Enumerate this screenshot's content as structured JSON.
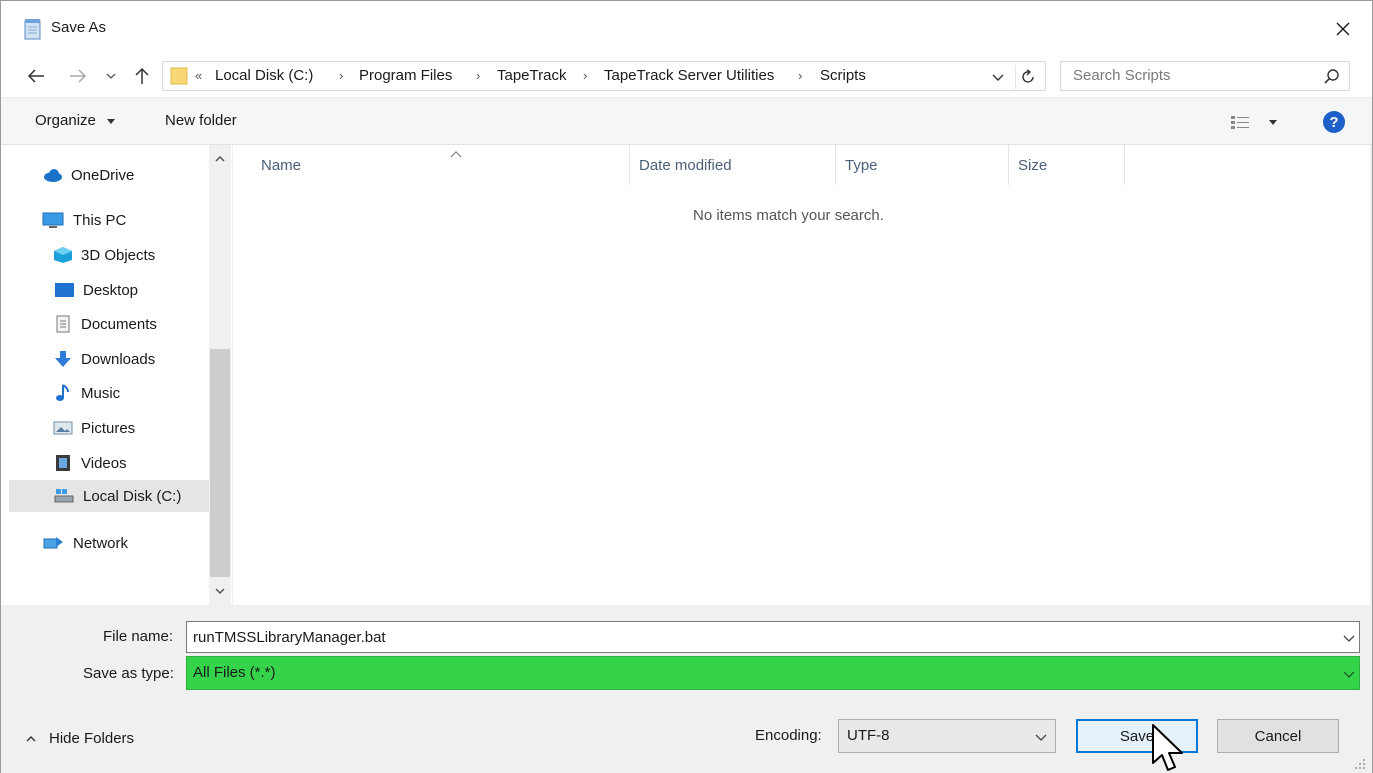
{
  "title": "Save As",
  "address": {
    "overflow": "«",
    "crumbs": [
      "Local Disk (C:)",
      "Program Files",
      "TapeTrack",
      "TapeTrack Server Utilities",
      "Scripts"
    ]
  },
  "search": {
    "placeholder": "Search Scripts"
  },
  "toolbar": {
    "organize_label": "Organize",
    "new_folder_label": "New folder",
    "help_label": "?"
  },
  "nav": {
    "items": [
      {
        "label": "OneDrive",
        "icon": "cloud-icon"
      },
      {
        "label": "This PC",
        "icon": "computer-icon"
      },
      {
        "label": "3D Objects",
        "icon": "cube-icon"
      },
      {
        "label": "Desktop",
        "icon": "desktop-icon"
      },
      {
        "label": "Documents",
        "icon": "document-icon"
      },
      {
        "label": "Downloads",
        "icon": "download-arrow-icon"
      },
      {
        "label": "Music",
        "icon": "music-note-icon"
      },
      {
        "label": "Pictures",
        "icon": "picture-icon"
      },
      {
        "label": "Videos",
        "icon": "film-icon"
      },
      {
        "label": "Local Disk (C:)",
        "icon": "drive-icon",
        "selected": true
      },
      {
        "label": "Network",
        "icon": "network-icon"
      }
    ]
  },
  "list": {
    "columns": [
      "Name",
      "Date modified",
      "Type",
      "Size"
    ],
    "empty_message": "No items match your search."
  },
  "form": {
    "filename_label": "File name:",
    "filename_value": "runTMSSLibraryManager.bat",
    "type_label": "Save as type:",
    "type_value": "All Files  (*.*)",
    "encoding_label": "Encoding:",
    "encoding_value": "UTF-8"
  },
  "footer": {
    "hide_folders_label": "Hide Folders",
    "save_label": "Save",
    "cancel_label": "Cancel"
  },
  "colors": {
    "accent": "#0078d7",
    "type_highlight": "#35d34a",
    "selected_nav": "#e5e5e5"
  }
}
